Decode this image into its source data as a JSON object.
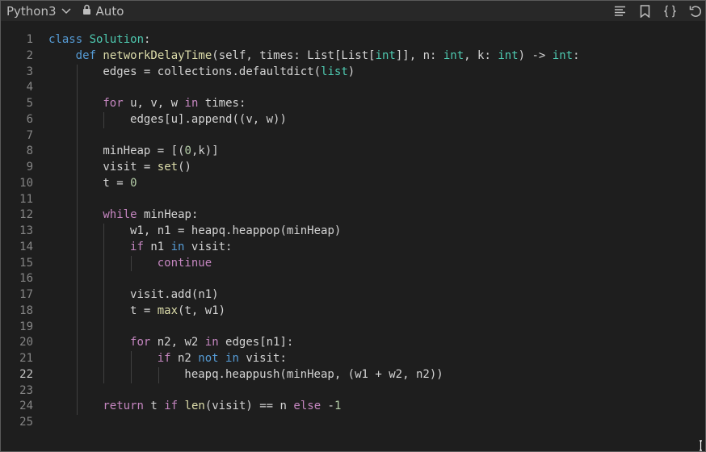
{
  "toolbar": {
    "language": "Python3",
    "mode": "Auto",
    "icons": [
      "list-icon",
      "bookmark-icon",
      "braces-icon",
      "undo-icon"
    ]
  },
  "editor": {
    "active_line": 22,
    "lines": [
      {
        "n": "1",
        "indent": 0,
        "tokens": [
          [
            "kd",
            "class"
          ],
          [
            "op",
            " "
          ],
          [
            "cls",
            "Solution"
          ],
          [
            "op",
            ":"
          ]
        ]
      },
      {
        "n": "2",
        "indent": 1,
        "tokens": [
          [
            "kd",
            "def"
          ],
          [
            "op",
            " "
          ],
          [
            "fn",
            "networkDelayTime"
          ],
          [
            "op",
            "(self, times: List[List["
          ],
          [
            "cls",
            "int"
          ],
          [
            "op",
            "]], n: "
          ],
          [
            "cls",
            "int"
          ],
          [
            "op",
            ", k: "
          ],
          [
            "cls",
            "int"
          ],
          [
            "op",
            ") -> "
          ],
          [
            "cls",
            "int"
          ],
          [
            "op",
            ":"
          ]
        ]
      },
      {
        "n": "3",
        "indent": 2,
        "tokens": [
          [
            "op",
            "edges = collections.defaultdict("
          ],
          [
            "cls",
            "list"
          ],
          [
            "op",
            ")"
          ]
        ]
      },
      {
        "n": "4",
        "indent": 2,
        "tokens": []
      },
      {
        "n": "5",
        "indent": 2,
        "tokens": [
          [
            "kw",
            "for"
          ],
          [
            "op",
            " u, v, w "
          ],
          [
            "kw",
            "in"
          ],
          [
            "op",
            " times:"
          ]
        ]
      },
      {
        "n": "6",
        "indent": 3,
        "tokens": [
          [
            "op",
            "edges[u].append((v, w))"
          ]
        ]
      },
      {
        "n": "7",
        "indent": 2,
        "tokens": []
      },
      {
        "n": "8",
        "indent": 2,
        "tokens": [
          [
            "op",
            "minHeap = [("
          ],
          [
            "num",
            "0"
          ],
          [
            "op",
            ",k)]"
          ]
        ]
      },
      {
        "n": "9",
        "indent": 2,
        "tokens": [
          [
            "op",
            "visit = "
          ],
          [
            "fn",
            "set"
          ],
          [
            "op",
            "()"
          ]
        ]
      },
      {
        "n": "10",
        "indent": 2,
        "tokens": [
          [
            "op",
            "t = "
          ],
          [
            "num",
            "0"
          ]
        ]
      },
      {
        "n": "11",
        "indent": 2,
        "tokens": []
      },
      {
        "n": "12",
        "indent": 2,
        "tokens": [
          [
            "kw",
            "while"
          ],
          [
            "op",
            " minHeap:"
          ]
        ]
      },
      {
        "n": "13",
        "indent": 3,
        "tokens": [
          [
            "op",
            "w1, n1 = heapq.heappop(minHeap)"
          ]
        ]
      },
      {
        "n": "14",
        "indent": 3,
        "tokens": [
          [
            "kw",
            "if"
          ],
          [
            "op",
            " n1 "
          ],
          [
            "kd",
            "in"
          ],
          [
            "op",
            " visit:"
          ]
        ]
      },
      {
        "n": "15",
        "indent": 4,
        "tokens": [
          [
            "kw",
            "continue"
          ]
        ]
      },
      {
        "n": "16",
        "indent": 3,
        "tokens": []
      },
      {
        "n": "17",
        "indent": 3,
        "tokens": [
          [
            "op",
            "visit.add(n1)"
          ]
        ]
      },
      {
        "n": "18",
        "indent": 3,
        "tokens": [
          [
            "op",
            "t = "
          ],
          [
            "fn",
            "max"
          ],
          [
            "op",
            "(t, w1)"
          ]
        ]
      },
      {
        "n": "19",
        "indent": 3,
        "tokens": []
      },
      {
        "n": "20",
        "indent": 3,
        "tokens": [
          [
            "kw",
            "for"
          ],
          [
            "op",
            " n2, w2 "
          ],
          [
            "kw",
            "in"
          ],
          [
            "op",
            " edges[n1]:"
          ]
        ]
      },
      {
        "n": "21",
        "indent": 4,
        "tokens": [
          [
            "kw",
            "if"
          ],
          [
            "op",
            " n2 "
          ],
          [
            "kd",
            "not"
          ],
          [
            "op",
            " "
          ],
          [
            "kd",
            "in"
          ],
          [
            "op",
            " visit:"
          ]
        ]
      },
      {
        "n": "22",
        "indent": 5,
        "tokens": [
          [
            "op",
            "heapq.heappush(minHeap, (w1 + w2, n2))"
          ]
        ]
      },
      {
        "n": "23",
        "indent": 2,
        "tokens": []
      },
      {
        "n": "24",
        "indent": 2,
        "tokens": [
          [
            "kw",
            "return"
          ],
          [
            "op",
            " t "
          ],
          [
            "kw",
            "if"
          ],
          [
            "op",
            " "
          ],
          [
            "fn",
            "len"
          ],
          [
            "op",
            "(visit) == n "
          ],
          [
            "kw",
            "else"
          ],
          [
            "op",
            " -"
          ],
          [
            "num",
            "1"
          ]
        ]
      },
      {
        "n": "25",
        "indent": 0,
        "tokens": []
      }
    ]
  }
}
